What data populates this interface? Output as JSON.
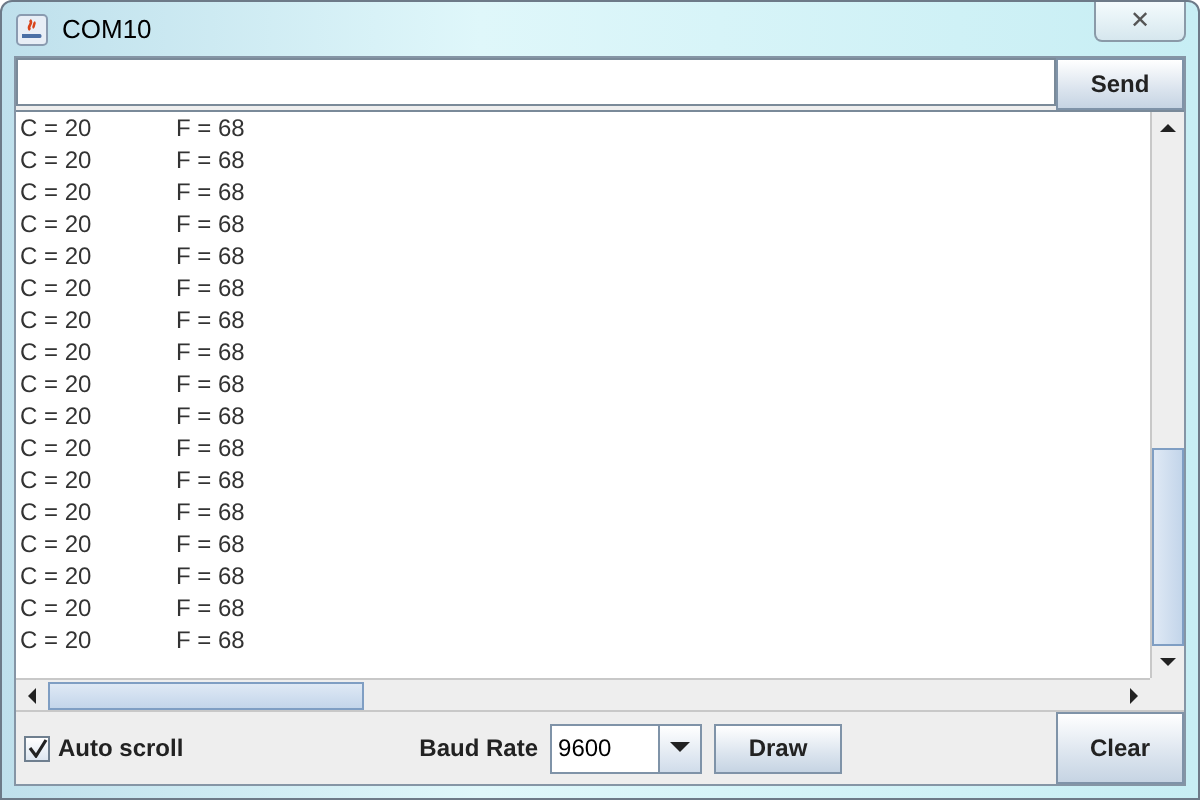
{
  "window": {
    "title": "COM10",
    "close": "✕"
  },
  "send_button": "Send",
  "lines": [
    [
      "C = 20",
      "F = 68"
    ],
    [
      "C = 20",
      "F = 68"
    ],
    [
      "C = 20",
      "F = 68"
    ],
    [
      "C = 20",
      "F = 68"
    ],
    [
      "C = 20",
      "F = 68"
    ],
    [
      "C = 20",
      "F = 68"
    ],
    [
      "C = 20",
      "F = 68"
    ],
    [
      "C = 20",
      "F = 68"
    ],
    [
      "C = 20",
      "F = 68"
    ],
    [
      "C = 20",
      "F = 68"
    ],
    [
      "C = 20",
      "F = 68"
    ],
    [
      "C = 20",
      "F = 68"
    ],
    [
      "C = 20",
      "F = 68"
    ],
    [
      "C = 20",
      "F = 68"
    ],
    [
      "C = 20",
      "F = 68"
    ],
    [
      "C = 20",
      "F = 68"
    ],
    [
      "C = 20",
      "F = 68"
    ]
  ],
  "auto_scroll": {
    "label": "Auto scroll",
    "checked": true
  },
  "baud_rate": {
    "label": "Baud Rate",
    "value": "9600"
  },
  "buttons": [
    "Draw",
    "Clear"
  ]
}
